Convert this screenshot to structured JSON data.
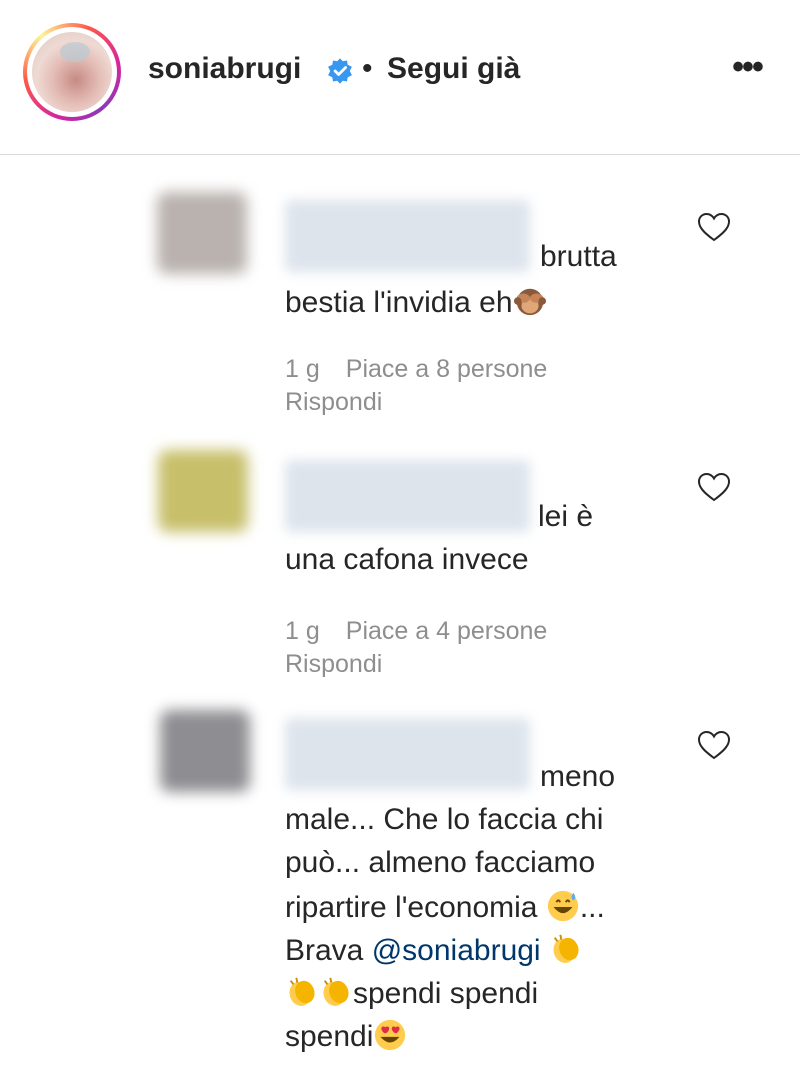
{
  "header": {
    "username": "soniabrugi",
    "separator": "•",
    "follow_status": "Segui già",
    "more_label": "•••"
  },
  "icons": {
    "verified": "verified-badge-icon",
    "like": "heart-icon",
    "more": "more-options-icon"
  },
  "colors": {
    "verified_blue": "#3897f0",
    "meta_grey": "#8e8e8e",
    "mention_blue": "#00376b"
  },
  "comments": [
    {
      "lines": [
        "brutta",
        "bestia l'invidia eh"
      ],
      "emojis": [
        "see-no-evil-monkey"
      ],
      "time": "1 g",
      "likes": "Piace a 8 persone",
      "reply": "Rispondi"
    },
    {
      "lines": [
        "lei è",
        "una cafona invece"
      ],
      "emojis": [],
      "time": "1 g",
      "likes": "Piace a 4 persone",
      "reply": "Rispondi"
    },
    {
      "lines": [
        "meno",
        "male... Che lo faccia chi",
        "può... almeno facciamo",
        "ripartire l'economia",
        "...",
        "Brava",
        "@soniabrugi",
        "spendi spendi",
        "spendi"
      ],
      "emojis": [
        "grinning-sweat",
        "clapping-hands",
        "clapping-hands",
        "clapping-hands",
        "heart-eyes"
      ]
    }
  ]
}
